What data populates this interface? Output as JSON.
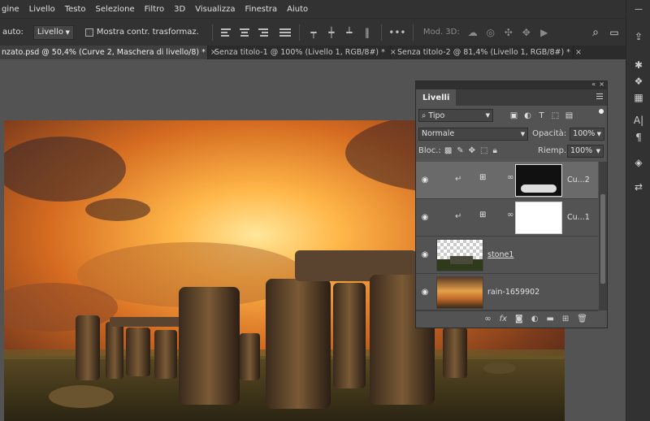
{
  "menu": [
    "gine",
    "Livello",
    "Testo",
    "Selezione",
    "Filtro",
    "3D",
    "Visualizza",
    "Finestra",
    "Aiuto"
  ],
  "options": {
    "auto_label": "auto:",
    "auto_select": "Livello",
    "transform_label": "Mostra contr. trasformaz.",
    "mod3d_label": "Mod. 3D:",
    "more": "•••"
  },
  "tabs": [
    {
      "label": "nzato.psd @ 50,4% (Curve 2, Maschera di livello/8) *",
      "close": "×"
    },
    {
      "label": "Senza titolo-1 @ 100% (Livello 1, RGB/8#) *",
      "close": "×"
    },
    {
      "label": "Senza titolo-2 @ 81,4% (Livello 1, RGB/8#) *",
      "close": "×"
    }
  ],
  "layers_panel": {
    "title": "Livelli",
    "collapse": "«",
    "close": "×",
    "filter_kind": "Tipo",
    "blend_mode": "Normale",
    "opacity_label": "Opacità:",
    "opacity_value": "100%",
    "lock_label": "Bloc.:",
    "fill_label": "Riemp.:",
    "fill_value": "100%",
    "layers": [
      {
        "name": "Cu...2",
        "type": "curves",
        "selected": true
      },
      {
        "name": "Cu...1",
        "type": "curves",
        "selected": false
      },
      {
        "name": "stone1",
        "type": "image",
        "selected": false
      },
      {
        "name": "rain-1659902",
        "type": "image",
        "selected": false
      }
    ]
  },
  "icons": {
    "eye": "eye-icon",
    "search": "search-icon",
    "share": "share-icon"
  }
}
